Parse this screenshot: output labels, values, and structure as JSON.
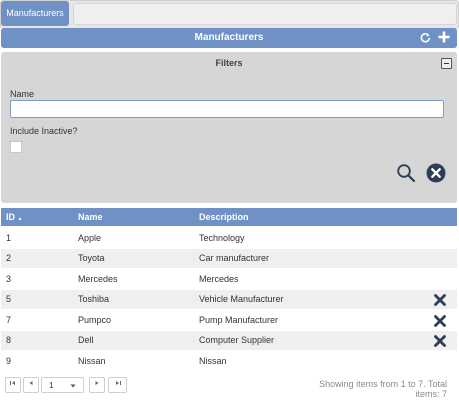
{
  "tabs": [
    {
      "label": "Manufacturers"
    }
  ],
  "header": {
    "title": "Manufacturers"
  },
  "filters": {
    "title": "Filters",
    "name_label": "Name",
    "name_value": "",
    "inactive_label": "Include Inactive?",
    "include_inactive": false
  },
  "table": {
    "columns": [
      "ID",
      "Name",
      "Description"
    ],
    "sort_indicator": "▲",
    "rows": [
      {
        "id": "1",
        "name": "Apple",
        "description": "Technology",
        "deletable": false
      },
      {
        "id": "2",
        "name": "Toyota",
        "description": "Car manufacturer",
        "deletable": false
      },
      {
        "id": "3",
        "name": "Mercedes",
        "description": "Mercedes",
        "deletable": false
      },
      {
        "id": "5",
        "name": "Toshiba",
        "description": "Vehicle Manufacturer",
        "deletable": true
      },
      {
        "id": "7",
        "name": "Pumpco",
        "description": "Pump Manufacturer",
        "deletable": true
      },
      {
        "id": "8",
        "name": "Dell",
        "description": "Computer Supplier",
        "deletable": true
      },
      {
        "id": "9",
        "name": "Nissan",
        "description": "Nissan",
        "deletable": false
      }
    ]
  },
  "pager": {
    "current_page": "1",
    "info": "Showing items from 1 to 7. Total items: 7"
  },
  "icons": {
    "refresh": "refresh-icon",
    "add": "plus-icon",
    "search": "search-icon",
    "clear": "clear-circle-icon",
    "delete": "x-icon"
  },
  "colors": {
    "accent": "#6f91c6",
    "panel": "#d6d6d6",
    "delete": "#2d3e55"
  }
}
